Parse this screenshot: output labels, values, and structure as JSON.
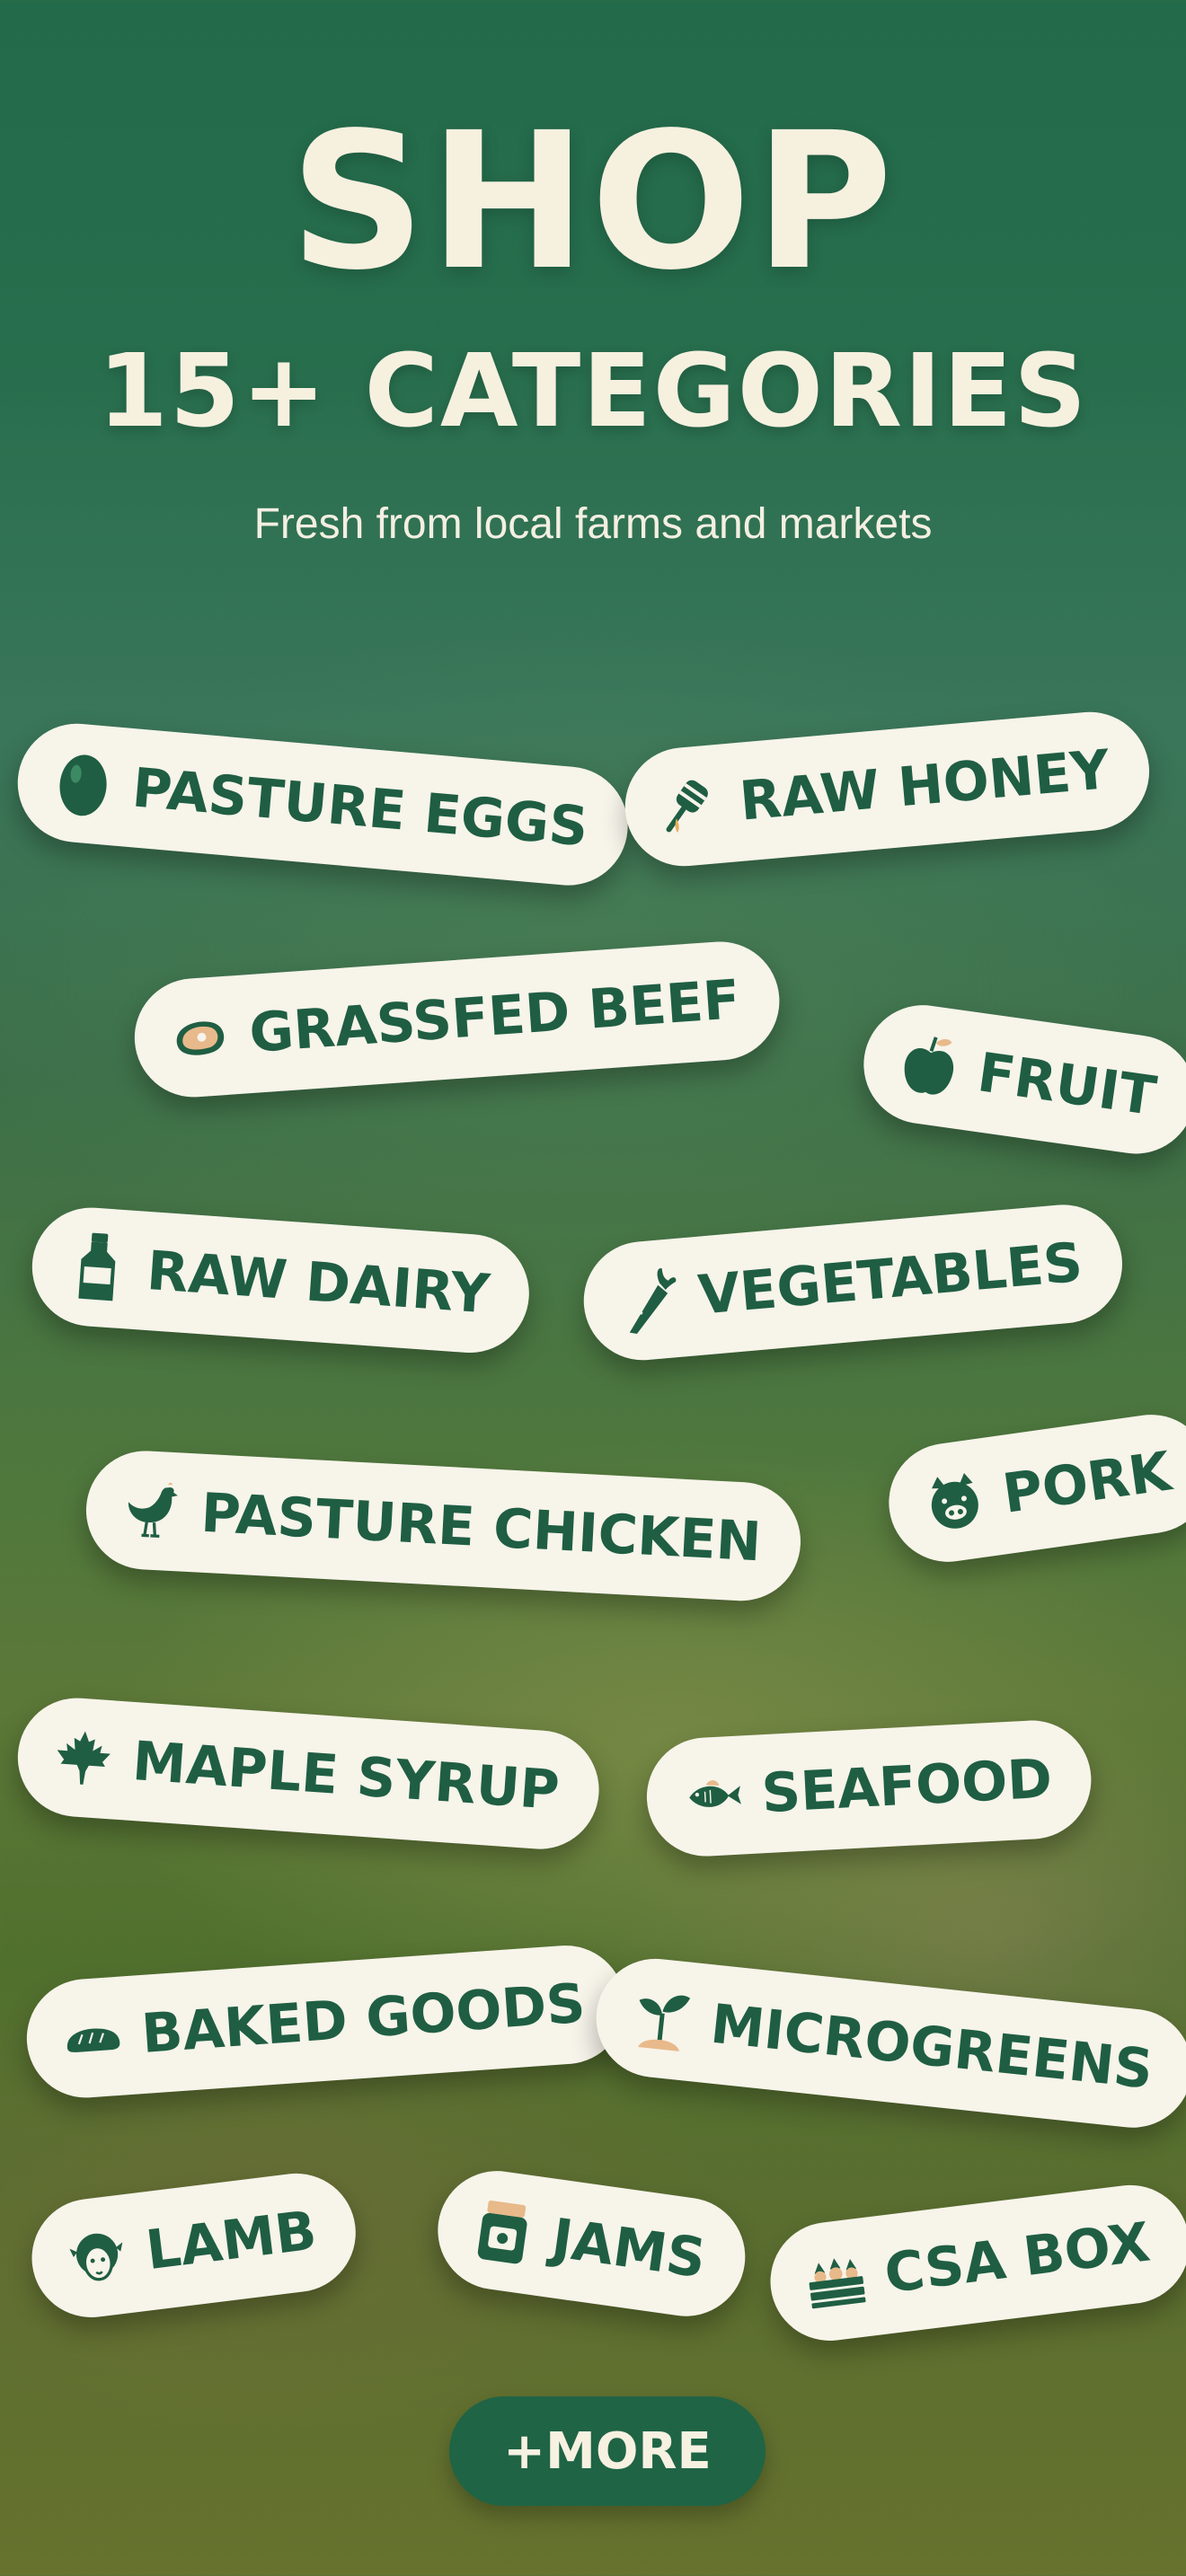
{
  "header": {
    "title": "SHOP",
    "subtitle": "15+ CATEGORIES",
    "tagline": "Fresh from local farms and markets"
  },
  "categories": [
    {
      "label": "PASTURE EGGS",
      "icon": "egg-icon"
    },
    {
      "label": "RAW HONEY",
      "icon": "honey-dipper-icon"
    },
    {
      "label": "GRASSFED BEEF",
      "icon": "steak-icon"
    },
    {
      "label": "FRUIT",
      "icon": "apple-icon"
    },
    {
      "label": "RAW DAIRY",
      "icon": "milk-bottle-icon"
    },
    {
      "label": "VEGETABLES",
      "icon": "carrot-icon"
    },
    {
      "label": "PASTURE CHICKEN",
      "icon": "chicken-icon"
    },
    {
      "label": "PORK",
      "icon": "pig-icon"
    },
    {
      "label": "MAPLE SYRUP",
      "icon": "maple-leaf-icon"
    },
    {
      "label": "SEAFOOD",
      "icon": "fish-icon"
    },
    {
      "label": "BAKED GOODS",
      "icon": "bread-icon"
    },
    {
      "label": "MICROGREENS",
      "icon": "sprout-icon"
    },
    {
      "label": "LAMB",
      "icon": "sheep-icon"
    },
    {
      "label": "JAMS",
      "icon": "jam-jar-icon"
    },
    {
      "label": "CSA BOX",
      "icon": "produce-crate-icon"
    }
  ],
  "more_button": {
    "label": "+MORE"
  },
  "colors": {
    "pill_text": "#1f5e43",
    "pill_bg": "#f7f4ea",
    "hero_text": "#f6f0df",
    "button_bg": "#1f6445"
  }
}
